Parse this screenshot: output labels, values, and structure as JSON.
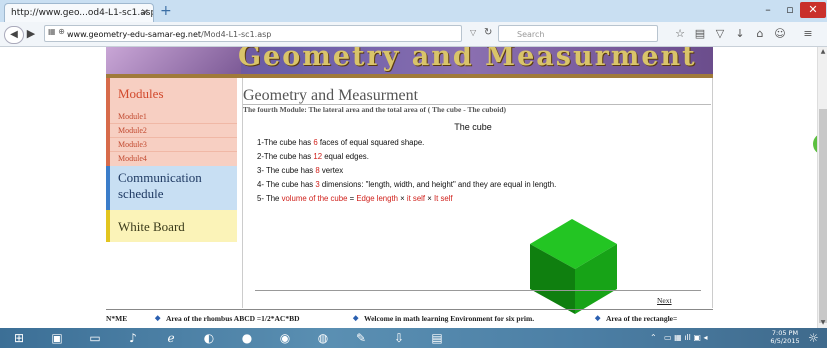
{
  "browser": {
    "tab_title": "http://www.geo...od4-L1-sc1.asp",
    "tab_close": "×",
    "new_tab": "+",
    "url_host": "www.geometry-edu-samar-eg.net",
    "url_path": "/Mod4-L1-sc1.asp",
    "search_placeholder": "Search",
    "window_min": "–",
    "window_max": "▫",
    "window_close": "✕"
  },
  "banner": {
    "title": "Geometry and Measurment"
  },
  "sidebar": {
    "modules_title": "Modules",
    "modules": [
      "Module1",
      "Module2",
      "Module3",
      "Module4"
    ],
    "communication": "Communication schedule",
    "white_board": "White Board"
  },
  "content": {
    "title": "Geometry and Measurment",
    "subtitle": "The fourth Module: The lateral area and the total area of ( The cube - The cuboid)",
    "heading": "The cube",
    "line1_a": "1-The cube has ",
    "line1_num": "6",
    "line1_b": " faces of equal squared shape.",
    "line2_a": "2-The cube has ",
    "line2_num": "12",
    "line2_b": " equal edges.",
    "line3_a": "3- The cube has ",
    "line3_num": "8",
    "line3_b": " vertex",
    "line4_a": "4- The cube has ",
    "line4_num": "3",
    "line4_b": " dimensions: \"length, width, and height\" and they are equal in length.",
    "line5_a": "5- The ",
    "line5_red1": "volume of the cube",
    "line5_b": "  = ",
    "line5_red2": "Edge length",
    "line5_c": " × ",
    "line5_red3": "it self",
    "line5_d": " × ",
    "line5_red4": "It self",
    "next": "Next",
    "cube_colors": {
      "top": "#23c523",
      "left": "#0f7f0f",
      "right": "#17a317"
    }
  },
  "ticker": {
    "item0": "N*ME",
    "item1": "Area of the rhombus ABCD =1/2*AC*BD",
    "item2": "Welcome in math learning Environment for six prim.",
    "item3": "Area of the rectangle="
  },
  "taskbar": {
    "time": "7:05 PM",
    "date": "6/5/2015"
  }
}
